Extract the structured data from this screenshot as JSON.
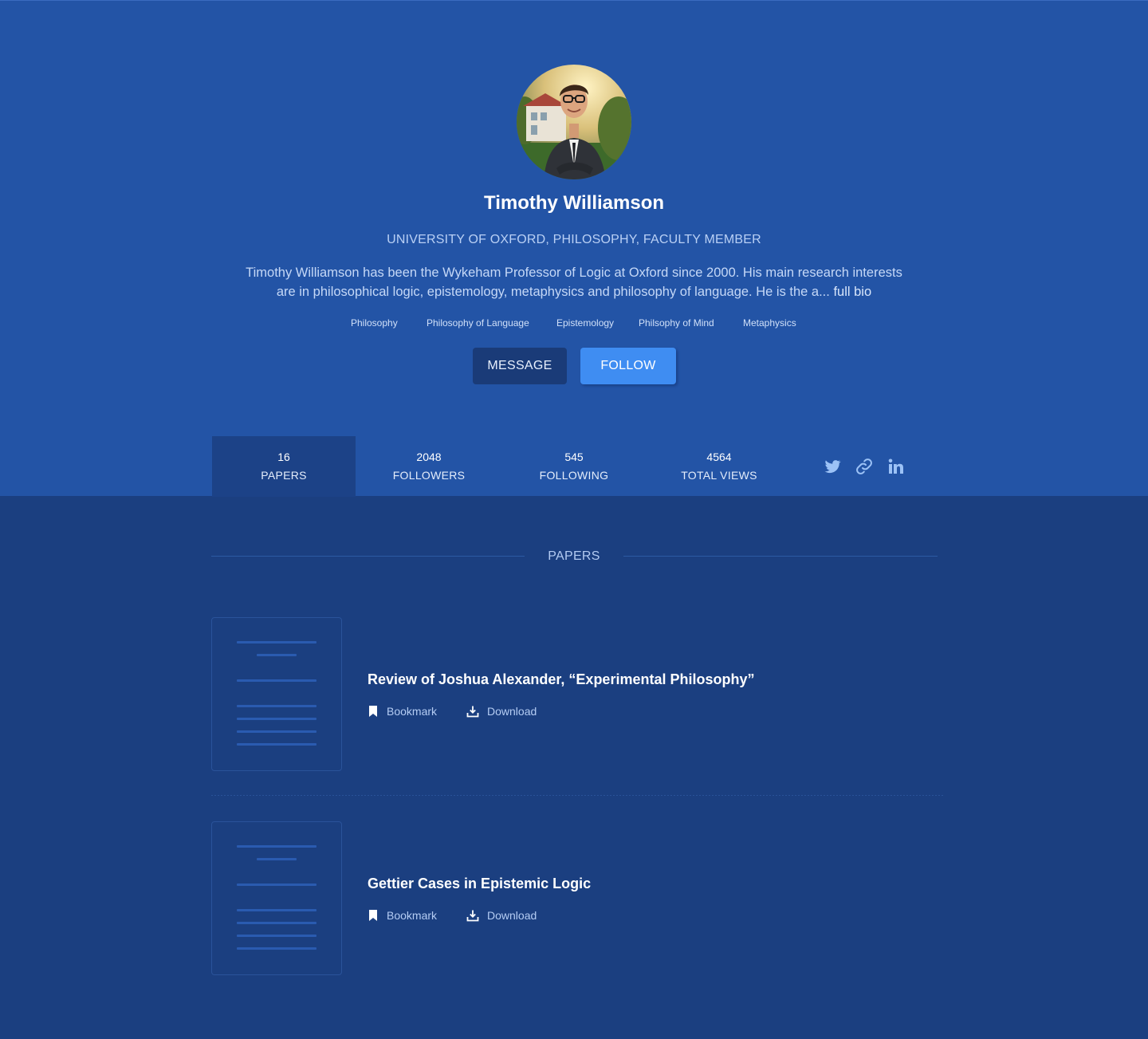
{
  "profile": {
    "name": "Timothy Williamson",
    "affiliation": "UNIVERSITY OF OXFORD, PHILOSOPHY, FACULTY MEMBER",
    "bio_line1": "Timothy Williamson has been the Wykeham Professor of Logic at Oxford since 2000. His main research interests",
    "bio_line2": "are in philosophical logic, epistemology, metaphysics and philosophy of language. He is the a...",
    "full_bio_link": "full bio",
    "tags": [
      "Philosophy",
      "Philosophy of Language",
      "Epistemology",
      "Philsophy of Mind",
      "Metaphysics"
    ]
  },
  "actions": {
    "message_label": "MESSAGE",
    "follow_label": "FOLLOW"
  },
  "stats": [
    {
      "value": "16",
      "label": "PAPERS",
      "active": true
    },
    {
      "value": "2048",
      "label": "FOLLOWERS",
      "active": false
    },
    {
      "value": "545",
      "label": "FOLLOWING",
      "active": false
    },
    {
      "value": "4564",
      "label": "TOTAL VIEWS",
      "active": false
    }
  ],
  "social_icons": [
    "twitter-icon",
    "link-icon",
    "linkedin-icon"
  ],
  "papers_section": {
    "title": "PAPERS",
    "items": [
      {
        "title": "Review of Joshua Alexander, “Experimental Philosophy”",
        "bookmark_label": "Bookmark",
        "download_label": "Download"
      },
      {
        "title": "Gettier Cases in Epistemic Logic",
        "bookmark_label": "Bookmark",
        "download_label": "Download"
      }
    ]
  },
  "colors": {
    "hero_background": "#2354a6",
    "page_background": "#1b3f80",
    "follow_button": "#3f8df2",
    "message_button": "#1a3b78",
    "active_stat": "#1c4287"
  }
}
